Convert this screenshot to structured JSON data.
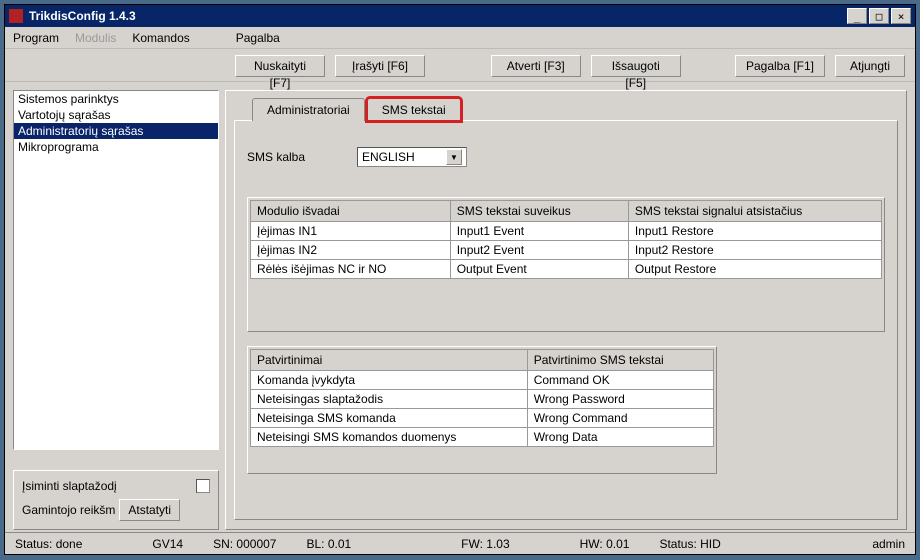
{
  "titlebar": {
    "title": "TrikdisConfig 1.4.3"
  },
  "menu": {
    "program": "Program",
    "modulis": "Modulis",
    "komandos": "Komandos",
    "pagalba": "Pagalba"
  },
  "toolbar": {
    "read": "Nuskaityti [F7]",
    "write": "Įrašyti [F6]",
    "open": "Atverti [F3]",
    "save": "Išsaugoti [F5]",
    "help": "Pagalba [F1]",
    "disconnect": "Atjungti"
  },
  "sidebar": {
    "items": [
      "Sistemos parinktys",
      "Vartotojų sąrašas",
      "Administratorių sąrašas",
      "Mikroprograma"
    ],
    "selected_index": 2
  },
  "resetbox": {
    "remember": "Įsiminti slaptažodį",
    "factory_label": "Gamintojo reikšm",
    "reset": "Atstatyti"
  },
  "tabs": [
    "Administratoriai",
    "SMS tekstai"
  ],
  "page": {
    "sms_lang_label": "SMS kalba",
    "sms_lang_value": "ENGLISH",
    "table1": {
      "headers": [
        "Modulio išvadai",
        "SMS tekstai suveikus",
        "SMS tekstai signalui atsistačius"
      ],
      "rows": [
        [
          "Įėjimas IN1",
          "Input1 Event",
          "Input1 Restore"
        ],
        [
          "Įėjimas IN2",
          "Input2 Event",
          "Input2 Restore"
        ],
        [
          "Rėlės išėjimas NC ir NO",
          "Output Event",
          "Output Restore"
        ]
      ]
    },
    "table2": {
      "headers": [
        "Patvirtinimai",
        "Patvirtinimo SMS tekstai"
      ],
      "rows": [
        [
          "Komanda įvykdyta",
          "Command OK"
        ],
        [
          "Neteisingas slaptažodis",
          "Wrong Password"
        ],
        [
          "Neteisinga SMS komanda",
          "Wrong Command"
        ],
        [
          "Neteisingi SMS komandos duomenys",
          "Wrong Data"
        ]
      ]
    }
  },
  "statusbar": {
    "status": "Status: done",
    "chip": "GV14",
    "sn": "SN: 000007",
    "bl": "BL: 0.01",
    "fw": "FW: 1.03",
    "hw": "HW: 0.01",
    "hid": "Status: HID",
    "user": "admin"
  },
  "winbtns": {
    "min": "_",
    "max": "□",
    "close": "×"
  }
}
